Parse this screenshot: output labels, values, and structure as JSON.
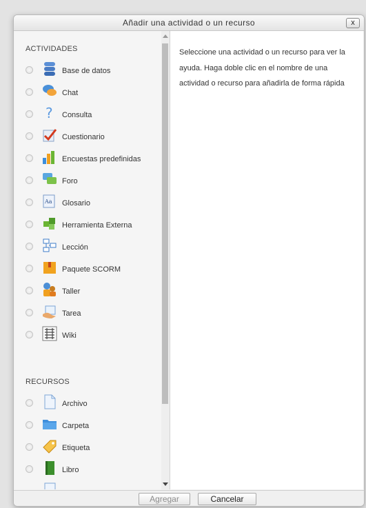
{
  "dialog": {
    "title": "Añadir una actividad o un recurso",
    "close_label": "x"
  },
  "sections": {
    "activities": "ACTIVIDADES",
    "resources": "RECURSOS"
  },
  "activities": [
    {
      "label": "Base de datos",
      "icon": "database-icon"
    },
    {
      "label": "Chat",
      "icon": "chat-icon"
    },
    {
      "label": "Consulta",
      "icon": "question-icon"
    },
    {
      "label": "Cuestionario",
      "icon": "checkmark-icon"
    },
    {
      "label": "Encuestas predefinidas",
      "icon": "bar-chart-icon"
    },
    {
      "label": "Foro",
      "icon": "forum-icon"
    },
    {
      "label": "Glosario",
      "icon": "glossary-icon"
    },
    {
      "label": "Herramienta Externa",
      "icon": "puzzle-icon"
    },
    {
      "label": "Lección",
      "icon": "lesson-icon"
    },
    {
      "label": "Paquete SCORM",
      "icon": "package-icon"
    },
    {
      "label": "Taller",
      "icon": "workshop-icon"
    },
    {
      "label": "Tarea",
      "icon": "assignment-icon"
    },
    {
      "label": "Wiki",
      "icon": "wiki-icon"
    }
  ],
  "resources": [
    {
      "label": "Archivo",
      "icon": "file-icon"
    },
    {
      "label": "Carpeta",
      "icon": "folder-icon"
    },
    {
      "label": "Etiqueta",
      "icon": "label-icon"
    },
    {
      "label": "Libro",
      "icon": "book-icon"
    }
  ],
  "help": {
    "text": "Seleccione una actividad o un recurso para ver la ayuda. Haga doble clic en el nombre de una actividad o recurso para añadirla de forma rápida"
  },
  "footer": {
    "add_label": "Agregar",
    "cancel_label": "Cancelar"
  }
}
